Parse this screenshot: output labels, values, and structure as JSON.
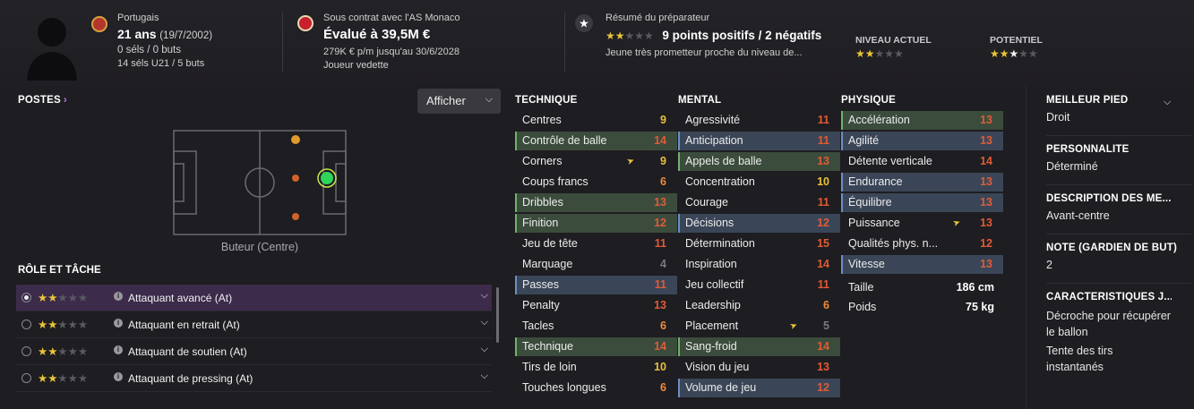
{
  "header": {
    "nationality": "Portugais",
    "age": "21 ans",
    "birthdate": "(19/7/2002)",
    "caps": "0 séls / 0 buts",
    "youth_caps": "14 séls U21 / 5 buts",
    "contract": "Sous contrat avec l'AS Monaco",
    "value": "Évalué à 39,5M €",
    "wage": "279K € p/m jusqu'au 30/6/2028",
    "squad_status": "Joueur vedette",
    "scout_title": "Résumé du préparateur",
    "scout_points": "9 points positifs / 2 négatifs",
    "scout_desc": "Jeune très prometteur proche du niveau de...",
    "current_label": "NIVEAU ACTUEL",
    "potential_label": "POTENTIEL",
    "scout_stars": 2,
    "current_stars": 2,
    "potential_stars": 2.5,
    "colors": {
      "accent_star": "#e9c53a",
      "selected_row": "#3c2b4b"
    }
  },
  "positions": {
    "title": "POSTES",
    "title_arrow": "›",
    "display_button": "Afficher",
    "caption": "Buteur (Centre)"
  },
  "roles": {
    "title": "RÔLE ET TÂCHE",
    "items": [
      {
        "name": "Attaquant avancé (At)",
        "stars": 2,
        "selected": true
      },
      {
        "name": "Attaquant en retrait (At)",
        "stars": 2,
        "selected": false
      },
      {
        "name": "Attaquant de soutien (At)",
        "stars": 2,
        "selected": false
      },
      {
        "name": "Attaquant de pressing (At)",
        "stars": 2,
        "selected": false
      }
    ]
  },
  "attributes": {
    "technique": {
      "title": "TECHNIQUE",
      "rows": [
        {
          "label": "Centres",
          "value": "9",
          "hl": "",
          "c": "v-yellow"
        },
        {
          "label": "Contrôle de balle",
          "value": "14",
          "hl": "hl-green",
          "c": "v-red"
        },
        {
          "label": "Corners",
          "value": "9",
          "hl": "",
          "c": "v-yellow",
          "trend": true
        },
        {
          "label": "Coups francs",
          "value": "6",
          "hl": "",
          "c": "v-orange"
        },
        {
          "label": "Dribbles",
          "value": "13",
          "hl": "hl-green",
          "c": "v-red"
        },
        {
          "label": "Finition",
          "value": "12",
          "hl": "hl-green",
          "c": "v-red"
        },
        {
          "label": "Jeu de tête",
          "value": "11",
          "hl": "",
          "c": "v-red"
        },
        {
          "label": "Marquage",
          "value": "4",
          "hl": "",
          "c": "v-grey"
        },
        {
          "label": "Passes",
          "value": "11",
          "hl": "hl-blue",
          "c": "v-red"
        },
        {
          "label": "Penalty",
          "value": "13",
          "hl": "",
          "c": "v-red"
        },
        {
          "label": "Tacles",
          "value": "6",
          "hl": "",
          "c": "v-orange"
        },
        {
          "label": "Technique",
          "value": "14",
          "hl": "hl-green",
          "c": "v-red"
        },
        {
          "label": "Tirs de loin",
          "value": "10",
          "hl": "",
          "c": "v-yellow"
        },
        {
          "label": "Touches longues",
          "value": "6",
          "hl": "",
          "c": "v-orange"
        }
      ]
    },
    "mental": {
      "title": "MENTAL",
      "rows": [
        {
          "label": "Agressivité",
          "value": "11",
          "hl": "",
          "c": "v-red"
        },
        {
          "label": "Anticipation",
          "value": "11",
          "hl": "hl-blue",
          "c": "v-red"
        },
        {
          "label": "Appels de balle",
          "value": "13",
          "hl": "hl-green",
          "c": "v-red"
        },
        {
          "label": "Concentration",
          "value": "10",
          "hl": "",
          "c": "v-yellow"
        },
        {
          "label": "Courage",
          "value": "11",
          "hl": "",
          "c": "v-red"
        },
        {
          "label": "Décisions",
          "value": "12",
          "hl": "hl-blue",
          "c": "v-red"
        },
        {
          "label": "Détermination",
          "value": "15",
          "hl": "",
          "c": "v-red"
        },
        {
          "label": "Inspiration",
          "value": "14",
          "hl": "",
          "c": "v-red"
        },
        {
          "label": "Jeu collectif",
          "value": "11",
          "hl": "",
          "c": "v-red"
        },
        {
          "label": "Leadership",
          "value": "6",
          "hl": "",
          "c": "v-orange"
        },
        {
          "label": "Placement",
          "value": "5",
          "hl": "",
          "c": "v-grey",
          "trend": true
        },
        {
          "label": "Sang-froid",
          "value": "14",
          "hl": "hl-green",
          "c": "v-red"
        },
        {
          "label": "Vision du jeu",
          "value": "13",
          "hl": "",
          "c": "v-red"
        },
        {
          "label": "Volume de jeu",
          "value": "12",
          "hl": "hl-blue",
          "c": "v-red"
        }
      ]
    },
    "physique": {
      "title": "PHYSIQUE",
      "rows": [
        {
          "label": "Accélération",
          "value": "13",
          "hl": "hl-green",
          "c": "v-red"
        },
        {
          "label": "Agilité",
          "value": "13",
          "hl": "hl-blue",
          "c": "v-red"
        },
        {
          "label": "Détente verticale",
          "value": "14",
          "hl": "",
          "c": "v-red"
        },
        {
          "label": "Endurance",
          "value": "13",
          "hl": "hl-blue",
          "c": "v-red"
        },
        {
          "label": "Équilibre",
          "value": "13",
          "hl": "hl-blue",
          "c": "v-red"
        },
        {
          "label": "Puissance",
          "value": "13",
          "hl": "",
          "c": "v-red",
          "trend": true
        },
        {
          "label": "Qualités phys. n...",
          "value": "12",
          "hl": "",
          "c": "v-red"
        },
        {
          "label": "Vitesse",
          "value": "13",
          "hl": "hl-blue",
          "c": "v-red"
        }
      ],
      "height_label": "Taille",
      "height_value": "186 cm",
      "weight_label": "Poids",
      "weight_value": "75 kg"
    }
  },
  "info": {
    "best_foot_title": "MEILLEUR PIED",
    "best_foot": "Droit",
    "personality_title": "PERSONNALITÉ",
    "personality": "Déterminé",
    "description_title": "DESCRIPTION DES MÉ...",
    "description": "Avant-centre",
    "gk_rating_title": "NOTE (GARDIEN DE BUT)",
    "gk_rating": "2",
    "traits_title": "CARACTÉRISTIQUES J...",
    "trait_1": "Décroche pour récupérer le ballon",
    "trait_2": "Tente des tirs instantanés"
  }
}
